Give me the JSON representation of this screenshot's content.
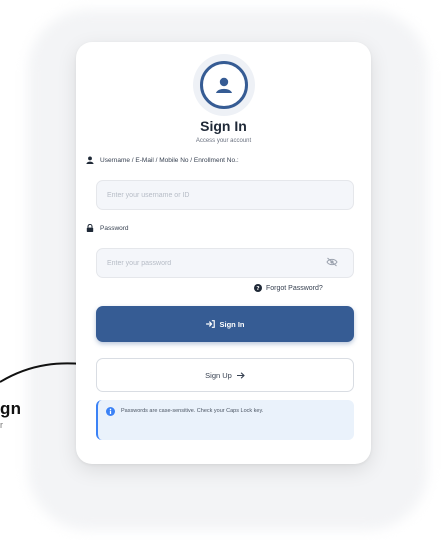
{
  "login": {
    "title": "Sign In",
    "subtitle": "Access your account",
    "username_label": "Username / E-Mail / Mobile No / Enrollment No.:",
    "username_placeholder": "Enter your username or ID",
    "password_label": "Password",
    "password_placeholder": "Enter your password",
    "forgot_label": "Forgot Password?",
    "signin_label": "Sign In",
    "signup_label": "Sign Up",
    "info_text": "Passwords are case-sensitive. Check your Caps Lock key."
  },
  "side": {
    "partial_label": "gn",
    "partial_sub": "r"
  },
  "colors": {
    "primary": "#365c94",
    "info_border": "#3b82f6",
    "info_bg": "#eaf2fb"
  },
  "icons": [
    "user-circle-icon",
    "user-icon",
    "lock-icon",
    "eye-slash-icon",
    "question-circle-icon",
    "sign-in-icon",
    "arrow-right-icon",
    "info-icon",
    "curved-arrow-icon"
  ]
}
